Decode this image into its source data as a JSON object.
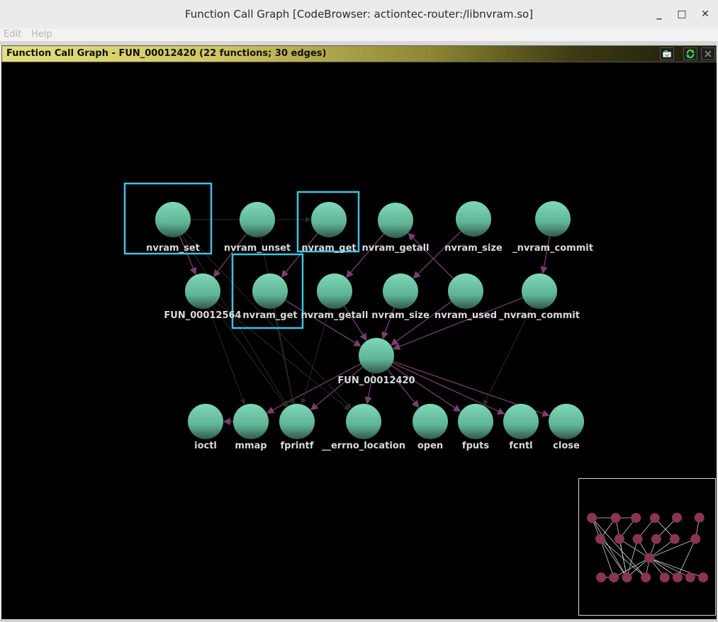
{
  "window": {
    "title": "Function Call Graph [CodeBrowser: actiontec-router:/libnvram.so]",
    "minimize_glyph": "_",
    "maximize_glyph": "□",
    "close_glyph": "✕"
  },
  "menubar": {
    "items": [
      "Edit",
      "Help"
    ]
  },
  "panel": {
    "title": "Function Call Graph - FUN_00012420 (22 functions; 30 edges)",
    "toolbar_icons": [
      "snapshot-icon",
      "refresh-icon",
      "close-icon"
    ]
  },
  "colors": {
    "node_fill": "#6fcaab",
    "edge_highlight": "#7a3d72",
    "edge_dim": "#2b2b2b",
    "selection_box": "#3ec3e6",
    "overview_node": "#8a3550",
    "canvas_bg": "#000000"
  },
  "graph": {
    "root": "FUN_00012420",
    "nodes": [
      {
        "id": "n1",
        "label": "nvram_set",
        "row": 0,
        "selected": true
      },
      {
        "id": "n2",
        "label": "nvram_unset",
        "row": 0,
        "selected": false
      },
      {
        "id": "n3",
        "label": "nvram_get",
        "row": 0,
        "selected": true
      },
      {
        "id": "n4",
        "label": "nvram_getall",
        "row": 0,
        "selected": false
      },
      {
        "id": "n5",
        "label": "nvram_size",
        "row": 0,
        "selected": false
      },
      {
        "id": "n6",
        "label": "_nvram_commit",
        "row": 0,
        "selected": false
      },
      {
        "id": "m1",
        "label": "FUN_00012564",
        "row": 1,
        "selected": false
      },
      {
        "id": "m2",
        "label": "nvram_get",
        "row": 1,
        "selected": true
      },
      {
        "id": "m3",
        "label": "nvram_getall",
        "row": 1,
        "selected": false
      },
      {
        "id": "m4",
        "label": "nvram_size",
        "row": 1,
        "selected": false
      },
      {
        "id": "m5",
        "label": "nvram_used",
        "row": 1,
        "selected": false
      },
      {
        "id": "m6",
        "label": "_nvram_commit",
        "row": 1,
        "selected": false
      },
      {
        "id": "c",
        "label": "FUN_00012420",
        "row": 2,
        "selected": false
      },
      {
        "id": "b1",
        "label": "ioctl",
        "row": 3,
        "selected": false
      },
      {
        "id": "b2",
        "label": "mmap",
        "row": 3,
        "selected": false
      },
      {
        "id": "b3",
        "label": "fprintf",
        "row": 3,
        "selected": false
      },
      {
        "id": "b4",
        "label": "__errno_location",
        "row": 3,
        "selected": false
      },
      {
        "id": "b5",
        "label": "open",
        "row": 3,
        "selected": false
      },
      {
        "id": "b6",
        "label": "fputs",
        "row": 3,
        "selected": false
      },
      {
        "id": "b7",
        "label": "fcntl",
        "row": 3,
        "selected": false
      },
      {
        "id": "b8",
        "label": "close",
        "row": 3,
        "selected": false
      }
    ],
    "edges": [
      {
        "from": "n1",
        "to": "m1",
        "highlight": true
      },
      {
        "from": "n2",
        "to": "m1",
        "highlight": true
      },
      {
        "from": "n3",
        "to": "m2",
        "highlight": true
      },
      {
        "from": "n4",
        "to": "m3",
        "highlight": true
      },
      {
        "from": "n5",
        "to": "m4",
        "highlight": true
      },
      {
        "from": "m5",
        "to": "n4",
        "highlight": true
      },
      {
        "from": "n6",
        "to": "m6",
        "highlight": true
      },
      {
        "from": "m2",
        "to": "c",
        "highlight": true
      },
      {
        "from": "m3",
        "to": "c",
        "highlight": true
      },
      {
        "from": "m4",
        "to": "c",
        "highlight": true
      },
      {
        "from": "m5",
        "to": "c",
        "highlight": true
      },
      {
        "from": "m6",
        "to": "c",
        "highlight": true
      },
      {
        "from": "c",
        "to": "b2",
        "highlight": true
      },
      {
        "from": "c",
        "to": "b3",
        "highlight": true
      },
      {
        "from": "c",
        "to": "b4",
        "highlight": true
      },
      {
        "from": "c",
        "to": "b5",
        "highlight": true
      },
      {
        "from": "c",
        "to": "b6",
        "highlight": true
      },
      {
        "from": "c",
        "to": "b7",
        "highlight": true
      },
      {
        "from": "c",
        "to": "b8",
        "highlight": true
      },
      {
        "from": "b2",
        "to": "b1",
        "highlight": true
      },
      {
        "from": "n1",
        "to": "b3",
        "highlight": false
      },
      {
        "from": "n1",
        "to": "b4",
        "highlight": false
      },
      {
        "from": "m1",
        "to": "b3",
        "highlight": false
      },
      {
        "from": "m1",
        "to": "b2",
        "highlight": false
      },
      {
        "from": "m1",
        "to": "b4",
        "highlight": false
      },
      {
        "from": "m2",
        "to": "b3",
        "highlight": false
      },
      {
        "from": "m3",
        "to": "b3",
        "highlight": false
      },
      {
        "from": "m6",
        "to": "b6",
        "highlight": false
      },
      {
        "from": "n2",
        "to": "b3",
        "highlight": false
      },
      {
        "from": "n1",
        "to": "n3",
        "highlight": false
      }
    ]
  }
}
